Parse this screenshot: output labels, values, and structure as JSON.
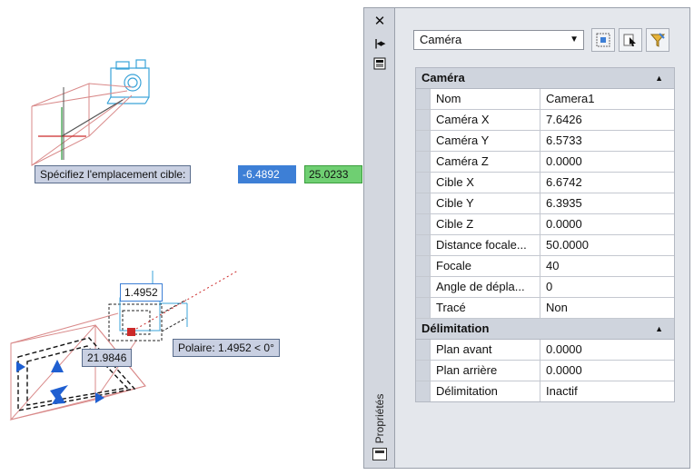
{
  "viewport": {
    "prompt_target": "Spécifiez l'emplacement cible:",
    "target_x": "-6.4892",
    "target_y": "25.0233",
    "distance_value": "1.4952",
    "length_value": "21.9846",
    "polar_tooltip": "Polaire: 1.4952 < 0°"
  },
  "palette": {
    "title": "Propriétés",
    "close_glyph": "✕",
    "autohide_glyph": "|◂▸",
    "selector_value": "Caméra",
    "sections": [
      {
        "title": "Caméra",
        "rows": [
          {
            "name": "Nom",
            "value": "Camera1"
          },
          {
            "name": "Caméra X",
            "value": "7.6426"
          },
          {
            "name": "Caméra Y",
            "value": "6.5733"
          },
          {
            "name": "Caméra Z",
            "value": "0.0000"
          },
          {
            "name": "Cible X",
            "value": "6.6742"
          },
          {
            "name": "Cible Y",
            "value": "6.3935"
          },
          {
            "name": "Cible Z",
            "value": "0.0000"
          },
          {
            "name": "Distance focale...",
            "value": "50.0000"
          },
          {
            "name": "Focale",
            "value": "40"
          },
          {
            "name": "Angle de dépla...",
            "value": "0"
          },
          {
            "name": "Tracé",
            "value": "Non"
          }
        ]
      },
      {
        "title": "Délimitation",
        "rows": [
          {
            "name": "Plan avant",
            "value": "0.0000"
          },
          {
            "name": "Plan arrière",
            "value": "0.0000"
          },
          {
            "name": "Délimitation",
            "value": "Inactif"
          }
        ]
      }
    ]
  },
  "colors": {
    "camera_glyph": "#3aa3d8",
    "frustum": "#d98a8a",
    "selection": "#3d7fd6",
    "grip": "#1f5fd1",
    "axis_red": "#cc2a2a",
    "axis_green": "#2a9a3a"
  }
}
